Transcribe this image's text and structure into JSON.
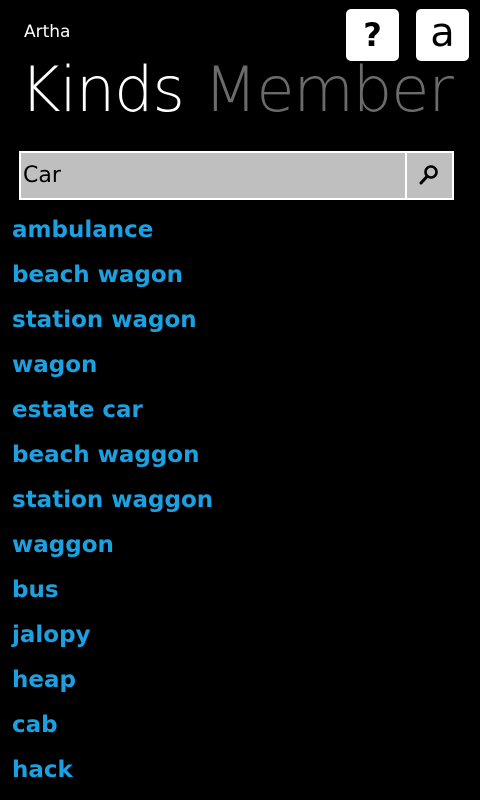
{
  "app": {
    "title": "Artha"
  },
  "header_buttons": {
    "help_label": "?",
    "about_label": "a"
  },
  "pivot": {
    "active": "Kinds",
    "next": "Member"
  },
  "search": {
    "value": "Car",
    "icon": "search-icon"
  },
  "colors": {
    "accent": "#1ba1e2",
    "background": "#000000",
    "search_bg": "#bfbfbf",
    "inactive_header": "#6b6b6b"
  },
  "results": [
    "ambulance",
    "beach wagon",
    "station wagon",
    "wagon",
    "estate car",
    "beach waggon",
    "station waggon",
    "waggon",
    "bus",
    "jalopy",
    "heap",
    "cab",
    "hack"
  ]
}
